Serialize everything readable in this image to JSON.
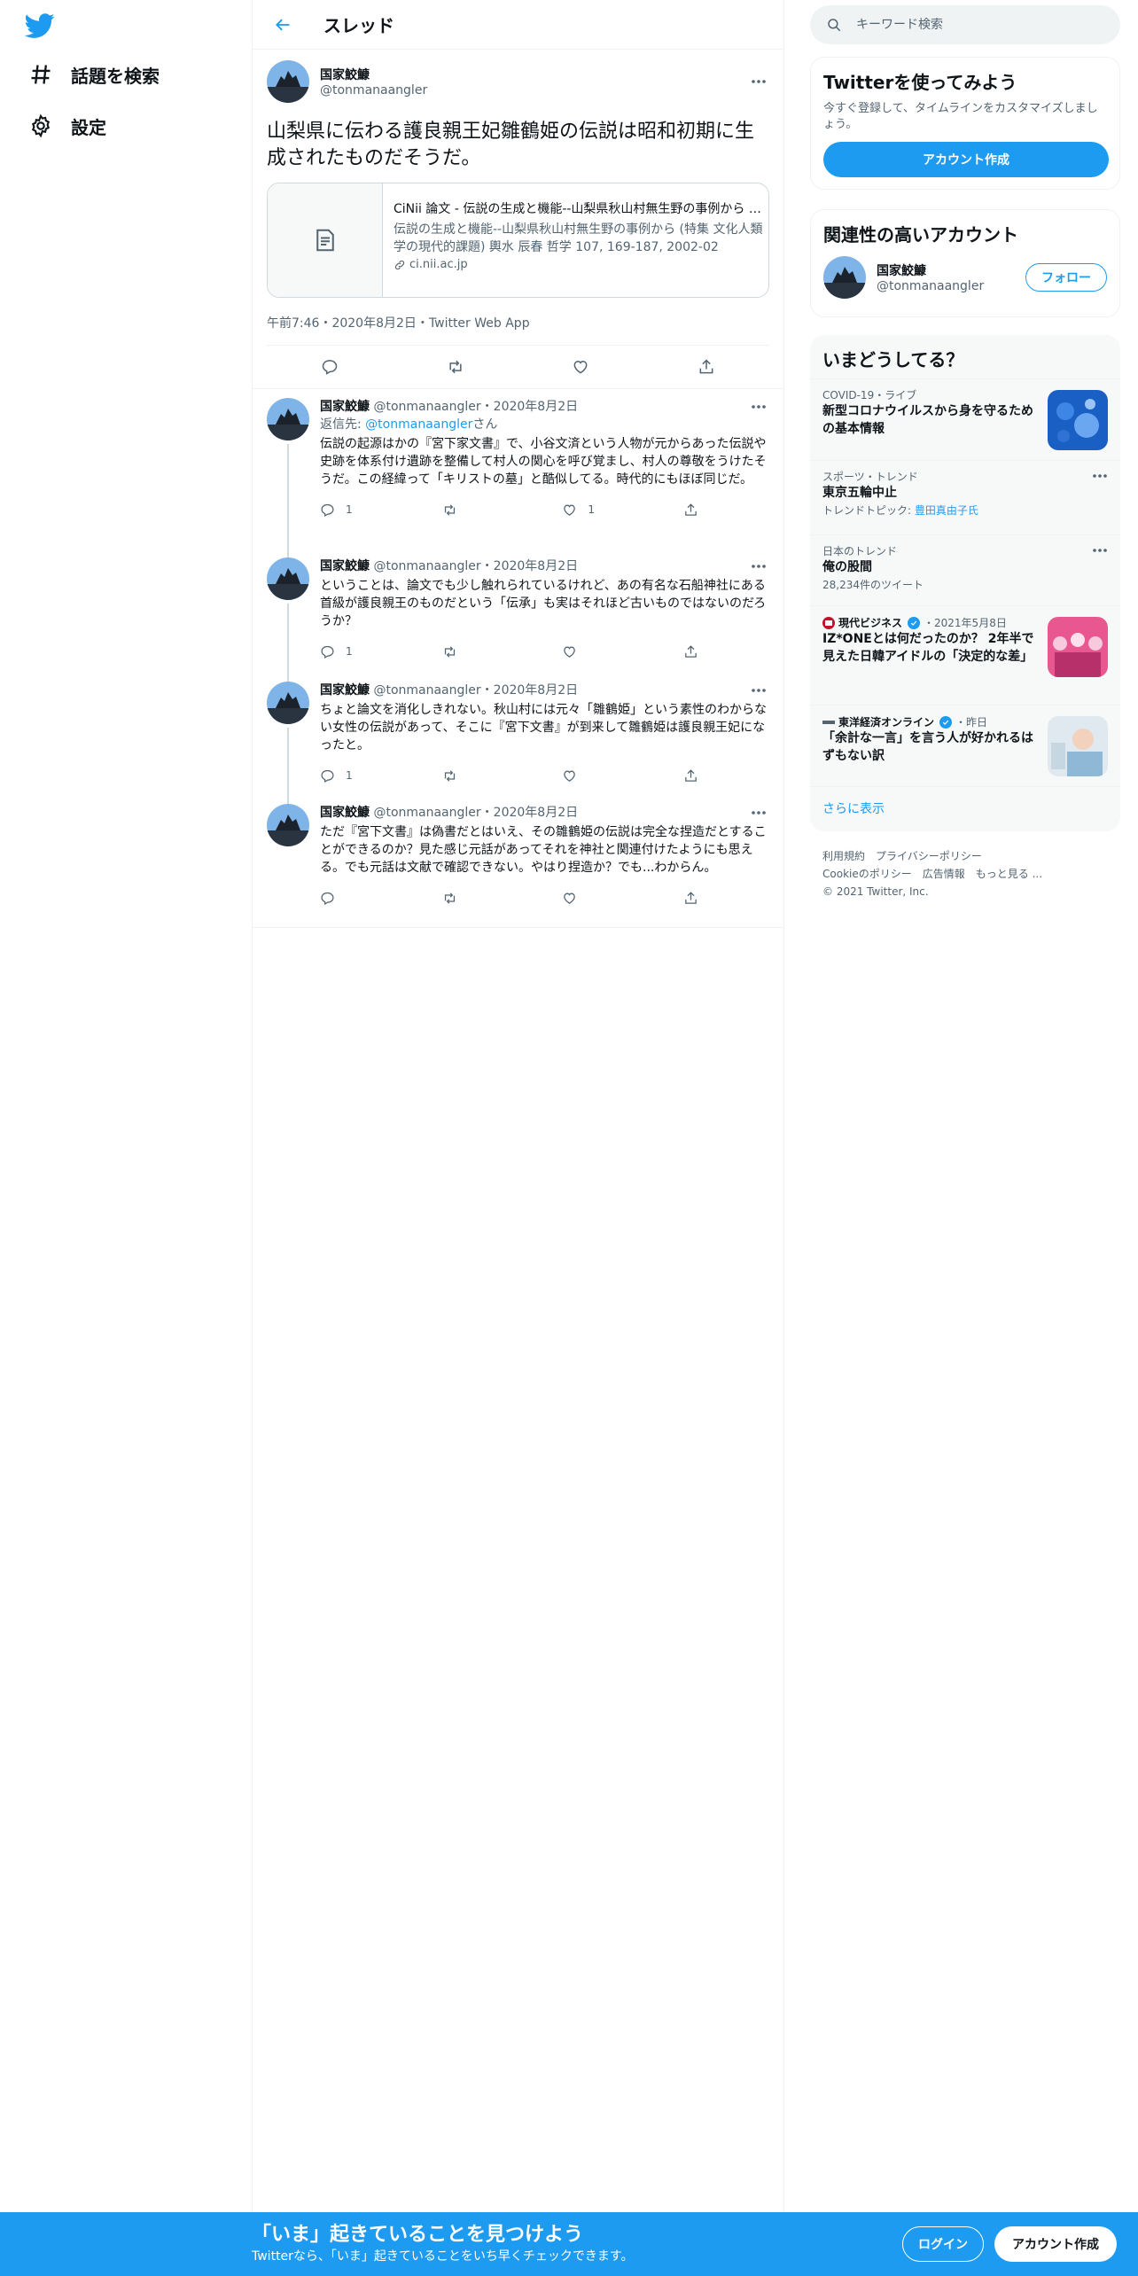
{
  "colors": {
    "accent": "#1d9bf0",
    "text": "#0f1419",
    "secondary": "#536471",
    "border": "#eff3f4"
  },
  "nav": {
    "logo_icon": "twitter-bird-icon",
    "items": [
      {
        "label": "話題を検索",
        "icon": "hashtag-icon"
      },
      {
        "label": "設定",
        "icon": "gear-icon"
      }
    ]
  },
  "header": {
    "title": "スレッド",
    "back_icon": "arrow-left-icon"
  },
  "main_tweet": {
    "name": "国家鮫鱇",
    "handle": "@tonmanaangler",
    "text": "山梨県に伝わる護良親王妃雛鶴姫の伝説は昭和初期に生成されたものだそうだ。",
    "card": {
      "title": "CiNii 論文 - 伝説の生成と機能--山梨県秋山村無生野の事例から (特集 文化人類学の現代的課題)",
      "description": "伝説の生成と機能--山梨県秋山村無生野の事例から (特集 文化人類学の現代的課題) 輿水 辰春 哲学 107, 169-187, 2002-02",
      "domain": "ci.nii.ac.jp"
    },
    "meta": "午前7:46・2020年8月2日・Twitter Web App"
  },
  "replies": [
    {
      "name": "国家鮫鱇",
      "handle": "@tonmanaangler",
      "sep": "・",
      "date": "2020年8月2日",
      "reply_to_prefix": "返信先: ",
      "reply_to_handle": "@tonmanaangler",
      "reply_to_suffix": "さん",
      "text": "伝説の起源はかの『宮下家文書』で、小谷文済という人物が元からあった伝説や史跡を体系付け遺跡を整備して村人の関心を呼び覚まし、村人の尊敬をうけたそうだ。この経緯って「キリストの墓」と酷似してる。時代的にもほぼ同じだ。",
      "reply_count": "1",
      "like_count": "1"
    },
    {
      "name": "国家鮫鱇",
      "handle": "@tonmanaangler",
      "sep": "・",
      "date": "2020年8月2日",
      "text": "ということは、論文でも少し触れられているけれど、あの有名な石船神社にある首級が護良親王のものだという「伝承」も実はそれほど古いものではないのだろうか？",
      "reply_count": "1",
      "like_count": ""
    },
    {
      "name": "国家鮫鱇",
      "handle": "@tonmanaangler",
      "sep": "・",
      "date": "2020年8月2日",
      "text": "ちょと論文を消化しきれない。秋山村には元々「雛鶴姫」という素性のわからない女性の伝説があって、そこに『宮下文書』が到来して雛鶴姫は護良親王妃になったと。",
      "reply_count": "1",
      "like_count": ""
    },
    {
      "name": "国家鮫鱇",
      "handle": "@tonmanaangler",
      "sep": "・",
      "date": "2020年8月2日",
      "text": "ただ『宮下文書』は偽書だとはいえ、その雛鶴姫の伝説は完全な捏造だとすることができるのか？見た感じ元話があってそれを神社と関連付けたようにも思える。でも元話は文献で確認できない。やはり捏造か？でも...わからん。",
      "reply_count": "",
      "like_count": ""
    }
  ],
  "search": {
    "placeholder": "キーワード検索",
    "icon": "search-icon"
  },
  "signup": {
    "title": "Twitterを使ってみよう",
    "text": "今すぐ登録して、タイムラインをカスタマイズしましょう。",
    "button": "アカウント作成"
  },
  "relevant": {
    "title": "関連性の高いアカウント",
    "name": "国家鮫鱇",
    "handle": "@tonmanaangler",
    "follow": "フォロー"
  },
  "trends": {
    "title": "いまどうしてる？",
    "items": [
      {
        "category": "COVID-19・ライブ",
        "title": "新型コロナウイルスから身を守るための基本情報"
      },
      {
        "category": "スポーツ・トレンド",
        "title": "東京五輪中止",
        "sub_prefix": "トレンドトピック: ",
        "sub_link": "豊田真由子氏"
      },
      {
        "category": "日本のトレンド",
        "title": "俺の股間",
        "sub": "28,234件のツイート"
      },
      {
        "source": "現代ビジネス",
        "time": "・2021年5月8日",
        "title": "IZ*ONEとは何だったのか？ 2年半で見えた日韓アイドルの「決定的な差」"
      },
      {
        "source": "東洋経済オンライン",
        "time": "・昨日",
        "title": "「余計な一言」を言う人が好かれるはずもない訳"
      }
    ],
    "show_more": "さらに表示"
  },
  "footer": {
    "links": [
      "利用規約",
      "プライバシーポリシー",
      "Cookieのポリシー",
      "広告情報",
      "もっと見る ..."
    ],
    "copyright": "© 2021 Twitter, Inc."
  },
  "bottom_bar": {
    "title": "「いま」起きていることを見つけよう",
    "subtitle": "Twitterなら、「いま」起きていることをいち早くチェックできます。",
    "login": "ログイン",
    "signup": "アカウント作成"
  }
}
